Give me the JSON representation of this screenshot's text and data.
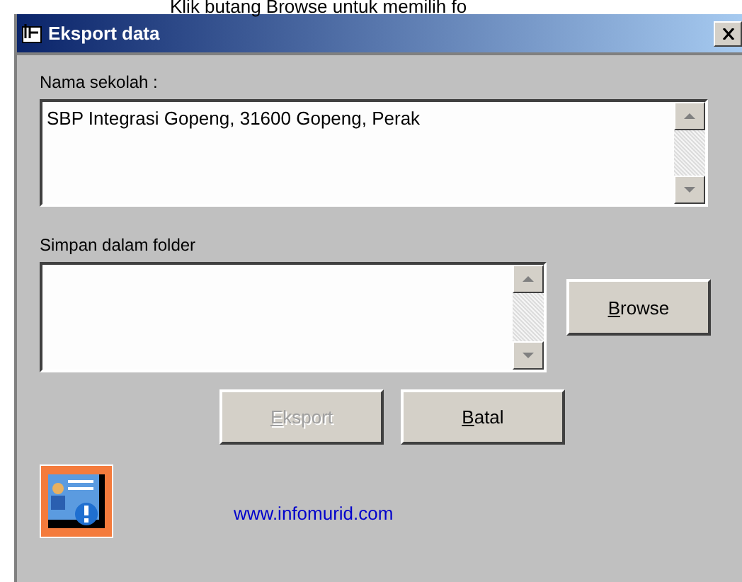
{
  "caption": "Klik butang Browse untuk memilih fo",
  "window": {
    "title": "Eksport data"
  },
  "school": {
    "label": "Nama sekolah :",
    "value": "SBP Integrasi Gopeng, 31600 Gopeng, Perak"
  },
  "folder": {
    "label": "Simpan dalam folder"
  },
  "browse_button": {
    "label": "Browse",
    "disabled": false
  },
  "buttons": [
    {
      "label": "Eksport",
      "disabled": true
    },
    {
      "label": "Batal",
      "disabled": false
    }
  ],
  "link": "www.infomurid.com"
}
